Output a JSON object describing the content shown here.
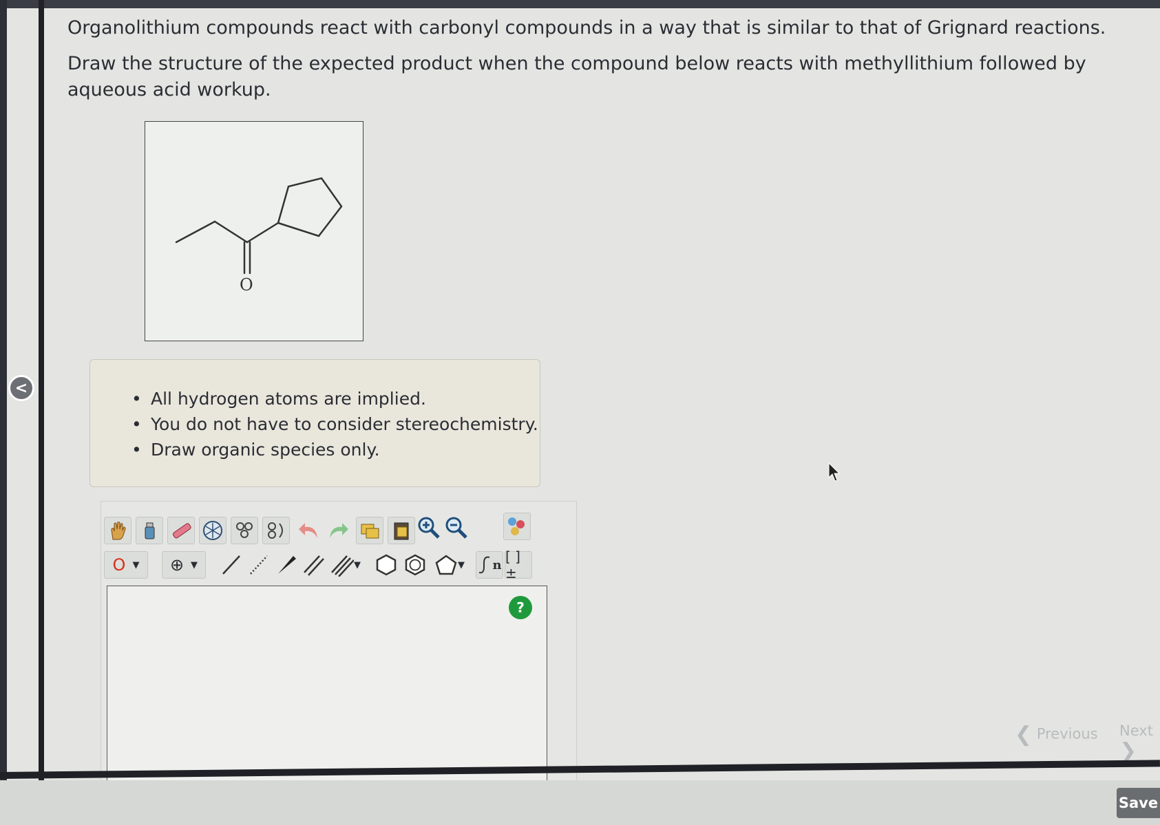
{
  "question": {
    "line1": "Organolithium compounds react with carbonyl compounds in a way that is similar to that of Grignard reactions.",
    "line2": "Draw the structure of the expected product when the compound below reacts with methyllithium followed by aqueous acid workup."
  },
  "molecule": {
    "oxygen_label": "O"
  },
  "notes": [
    "All hydrogen atoms are implied.",
    "You do not have to consider stereochemistry.",
    "Draw organic species only."
  ],
  "toolbar": {
    "atom_selector": "O",
    "charge_symbol": "⊕",
    "sn_label": "n",
    "bracket_label": "[ ]±",
    "help_label": "?"
  },
  "nav": {
    "previous_label": "Previous",
    "next_label": "Next",
    "save_label": "Save"
  },
  "colors": {
    "background": "#e4e5e2",
    "help_green": "#1e9a3c",
    "atom_red": "#d9301a"
  }
}
